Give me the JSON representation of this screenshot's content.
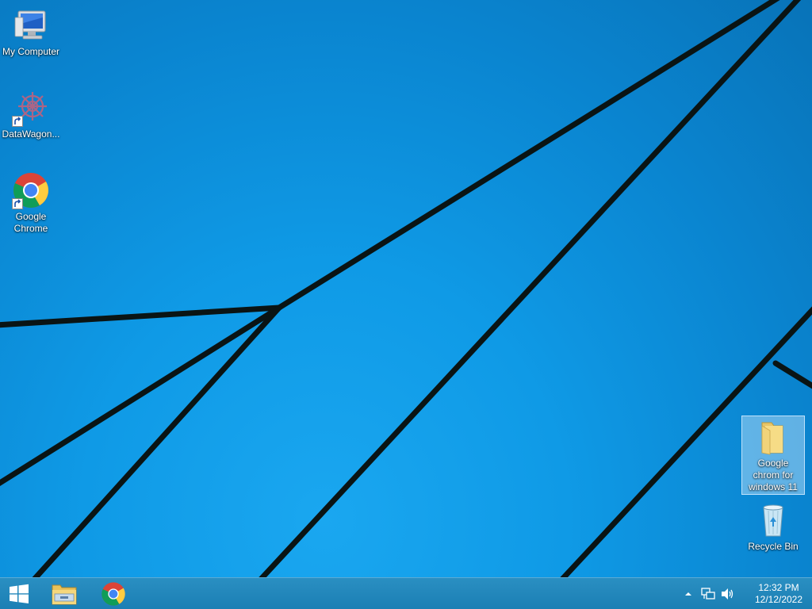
{
  "desktop": {
    "icons": [
      {
        "label": "My Computer",
        "icon": "computer-icon",
        "shortcut": false
      },
      {
        "label": "DataWagon...",
        "icon": "datawagon-gear-icon",
        "shortcut": true
      },
      {
        "label": "Google Chrome",
        "icon": "chrome-icon",
        "shortcut": true
      },
      {
        "label": "Google chrom for windows 11",
        "icon": "folder-icon",
        "shortcut": false,
        "selected": true
      },
      {
        "label": "Recycle Bin",
        "icon": "recycle-bin-icon",
        "shortcut": false
      }
    ]
  },
  "taskbar": {
    "pinned": [
      {
        "name": "start-button",
        "icon": "windows-logo-icon"
      },
      {
        "name": "file-explorer-button",
        "icon": "file-explorer-icon"
      },
      {
        "name": "chrome-taskbar-button",
        "icon": "chrome-icon"
      }
    ],
    "tray": {
      "icons": [
        "show-hidden-icons-chevron-icon",
        "network-icon",
        "volume-icon"
      ],
      "time": "12:32 PM",
      "date": "12/12/2022"
    }
  },
  "colors": {
    "wallpaper_blue": "#0f9ae6",
    "wallpaper_dark_blue": "#0873b8",
    "taskbar": "#1b7fb4",
    "wallpaper_lines": "#0a1a1a"
  }
}
